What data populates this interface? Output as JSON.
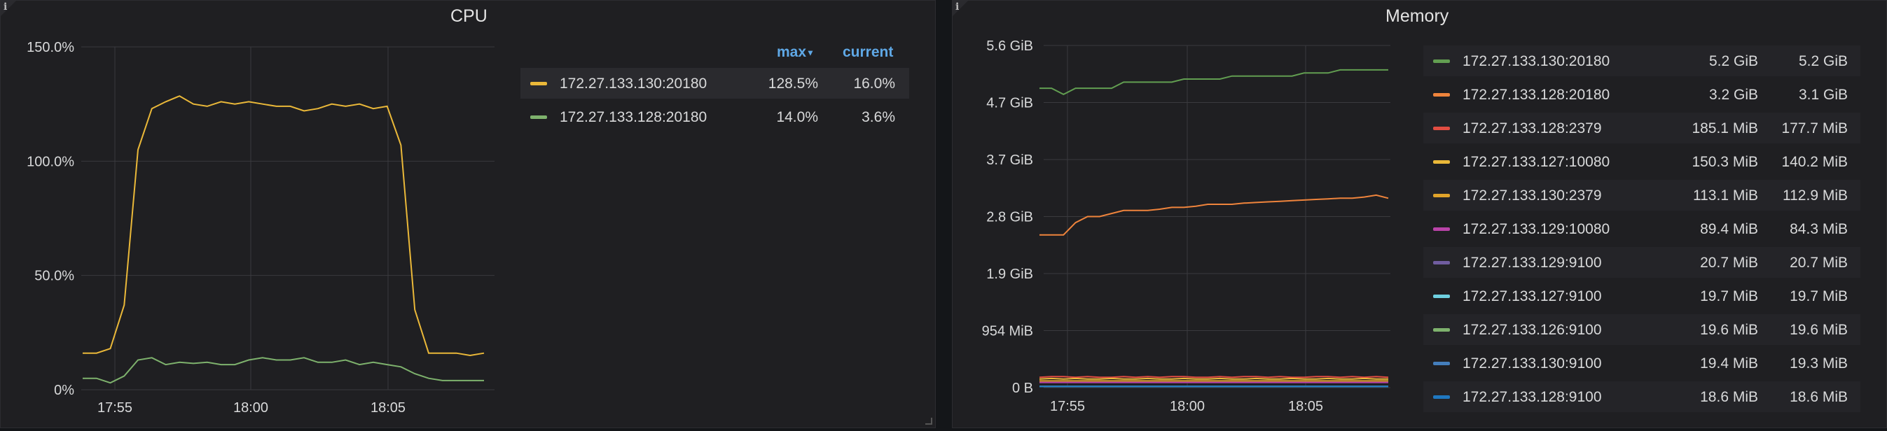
{
  "cpu_panel": {
    "title": "CPU",
    "info_icon": "i",
    "legend_headers": {
      "max": "max",
      "current": "current"
    },
    "legend": [
      {
        "name": "172.27.133.130:20180",
        "max": "128.5%",
        "current": "16.0%",
        "color": "#eab839"
      },
      {
        "name": "172.27.133.128:20180",
        "max": "14.0%",
        "current": "3.6%",
        "color": "#7eb26d"
      }
    ]
  },
  "memory_panel": {
    "title": "Memory",
    "info_icon": "i",
    "legend": [
      {
        "name": "172.27.133.130:20180",
        "max": "5.2 GiB",
        "current": "5.2 GiB",
        "color": "#629e51"
      },
      {
        "name": "172.27.133.128:20180",
        "max": "3.2 GiB",
        "current": "3.1 GiB",
        "color": "#ef843c"
      },
      {
        "name": "172.27.133.128:2379",
        "max": "185.1 MiB",
        "current": "177.7 MiB",
        "color": "#e24d42"
      },
      {
        "name": "172.27.133.127:10080",
        "max": "150.3 MiB",
        "current": "140.2 MiB",
        "color": "#eab839"
      },
      {
        "name": "172.27.133.130:2379",
        "max": "113.1 MiB",
        "current": "112.9 MiB",
        "color": "#e0a32a"
      },
      {
        "name": "172.27.133.129:10080",
        "max": "89.4 MiB",
        "current": "84.3 MiB",
        "color": "#ba43a9"
      },
      {
        "name": "172.27.133.129:9100",
        "max": "20.7 MiB",
        "current": "20.7 MiB",
        "color": "#705da0"
      },
      {
        "name": "172.27.133.127:9100",
        "max": "19.7 MiB",
        "current": "19.7 MiB",
        "color": "#6ed0e0"
      },
      {
        "name": "172.27.133.126:9100",
        "max": "19.6 MiB",
        "current": "19.6 MiB",
        "color": "#7eb26d"
      },
      {
        "name": "172.27.133.130:9100",
        "max": "19.4 MiB",
        "current": "19.3 MiB",
        "color": "#447ebc"
      },
      {
        "name": "172.27.133.128:9100",
        "max": "18.6 MiB",
        "current": "18.6 MiB",
        "color": "#1f78c1"
      }
    ]
  },
  "chart_data": [
    {
      "type": "line",
      "title": "CPU",
      "y_ticks": [
        "0%",
        "50.0%",
        "100.0%",
        "150.0%"
      ],
      "ylim": [
        0,
        150
      ],
      "x_ticks": [
        "17:55",
        "18:00",
        "18:05"
      ],
      "x": [
        "17:53:00",
        "17:53:30",
        "17:54:00",
        "17:54:30",
        "17:55:00",
        "17:55:30",
        "17:56:00",
        "17:56:30",
        "17:57:00",
        "17:57:30",
        "17:58:00",
        "17:58:30",
        "17:59:00",
        "17:59:30",
        "18:00:00",
        "18:00:30",
        "18:01:00",
        "18:01:30",
        "18:02:00",
        "18:02:30",
        "18:03:00",
        "18:03:30",
        "18:04:00",
        "18:04:30",
        "18:05:00",
        "18:05:30",
        "18:06:00",
        "18:06:30",
        "18:07:00",
        "18:07:30",
        "18:08:00",
        "18:08:30",
        "18:09:00",
        "18:09:30"
      ],
      "grid": true,
      "legend_position": "right",
      "series": [
        {
          "name": "172.27.133.130:20180",
          "color": "#eab839",
          "values": [
            16,
            16,
            18,
            37,
            105,
            123,
            126,
            128.5,
            125,
            124,
            126,
            125,
            126,
            125,
            124,
            124,
            122,
            123,
            125,
            124,
            125,
            123,
            124,
            107,
            35,
            16,
            16,
            16,
            15,
            16
          ]
        },
        {
          "name": "172.27.133.128:20180",
          "color": "#7eb26d",
          "values": [
            5,
            5,
            3,
            6,
            13,
            14,
            11,
            12,
            11.5,
            12,
            11,
            11,
            13,
            14,
            13,
            13,
            14,
            12,
            12,
            13,
            11,
            12,
            11,
            10,
            7,
            5,
            4,
            4,
            4,
            4
          ]
        }
      ]
    },
    {
      "type": "line",
      "title": "Memory",
      "y_ticks": [
        "0 B",
        "954 MiB",
        "1.9 GiB",
        "2.8 GiB",
        "3.7 GiB",
        "4.7 GiB",
        "5.6 GiB"
      ],
      "ylim": [
        0,
        5.6
      ],
      "y_unit": "GiB",
      "x_ticks": [
        "17:55",
        "18:00",
        "18:05"
      ],
      "grid": true,
      "legend_position": "right",
      "series": [
        {
          "name": "172.27.133.130:20180",
          "color": "#629e51",
          "values": [
            4.9,
            4.9,
            4.8,
            4.9,
            4.9,
            4.9,
            4.9,
            5.0,
            5.0,
            5.0,
            5.0,
            5.0,
            5.05,
            5.05,
            5.05,
            5.05,
            5.1,
            5.1,
            5.1,
            5.1,
            5.1,
            5.1,
            5.15,
            5.15,
            5.15,
            5.2,
            5.2,
            5.2,
            5.2,
            5.2
          ]
        },
        {
          "name": "172.27.133.128:20180",
          "color": "#ef843c",
          "values": [
            2.5,
            2.5,
            2.5,
            2.7,
            2.8,
            2.8,
            2.85,
            2.9,
            2.9,
            2.9,
            2.92,
            2.95,
            2.95,
            2.97,
            3.0,
            3.0,
            3.0,
            3.02,
            3.03,
            3.04,
            3.05,
            3.06,
            3.07,
            3.08,
            3.09,
            3.1,
            3.1,
            3.12,
            3.15,
            3.1
          ]
        },
        {
          "name": "172.27.133.128:2379",
          "color": "#e24d42",
          "values": [
            0.17,
            0.18,
            0.18,
            0.17,
            0.18,
            0.17,
            0.17,
            0.18,
            0.17,
            0.18,
            0.17,
            0.18,
            0.18,
            0.17,
            0.17,
            0.18,
            0.17,
            0.18,
            0.18,
            0.17,
            0.18,
            0.17,
            0.17,
            0.18,
            0.18,
            0.17,
            0.18,
            0.17,
            0.18,
            0.17
          ]
        },
        {
          "name": "172.27.133.127:10080",
          "color": "#eab839",
          "values": [
            0.14,
            0.15,
            0.14,
            0.15,
            0.14,
            0.14,
            0.15,
            0.14,
            0.14,
            0.15,
            0.14,
            0.14,
            0.15,
            0.14,
            0.14,
            0.15,
            0.14,
            0.14,
            0.15,
            0.14,
            0.14,
            0.15,
            0.14,
            0.14,
            0.15,
            0.14,
            0.14,
            0.15,
            0.14,
            0.14
          ]
        },
        {
          "name": "172.27.133.130:2379",
          "color": "#e0a32a",
          "values": [
            0.11,
            0.11,
            0.11,
            0.11,
            0.11,
            0.11,
            0.11,
            0.11,
            0.11,
            0.11,
            0.11,
            0.11,
            0.11,
            0.11,
            0.11,
            0.11,
            0.11,
            0.11,
            0.11,
            0.11,
            0.11,
            0.11,
            0.11,
            0.11,
            0.11,
            0.11,
            0.11,
            0.11,
            0.11,
            0.11
          ]
        },
        {
          "name": "172.27.133.129:10080",
          "color": "#ba43a9",
          "values": [
            0.085,
            0.085,
            0.085,
            0.085,
            0.085,
            0.085,
            0.085,
            0.085,
            0.085,
            0.085,
            0.085,
            0.085,
            0.085,
            0.085,
            0.085,
            0.085,
            0.085,
            0.085,
            0.085,
            0.085,
            0.085,
            0.085,
            0.085,
            0.085,
            0.085,
            0.085,
            0.085,
            0.085,
            0.085,
            0.085
          ]
        },
        {
          "name": "172.27.133.129:9100",
          "color": "#705da0",
          "values": [
            0.02,
            0.02,
            0.02,
            0.02,
            0.02,
            0.02,
            0.02,
            0.02,
            0.02,
            0.02,
            0.02,
            0.02,
            0.02,
            0.02,
            0.02,
            0.02,
            0.02,
            0.02,
            0.02,
            0.02,
            0.02,
            0.02,
            0.02,
            0.02,
            0.02,
            0.02,
            0.02,
            0.02,
            0.02,
            0.02
          ]
        },
        {
          "name": "172.27.133.127:9100",
          "color": "#6ed0e0",
          "values": [
            0.019,
            0.019,
            0.019,
            0.019,
            0.019,
            0.019,
            0.019,
            0.019,
            0.019,
            0.019,
            0.019,
            0.019,
            0.019,
            0.019,
            0.019,
            0.019,
            0.019,
            0.019,
            0.019,
            0.019,
            0.019,
            0.019,
            0.019,
            0.019,
            0.019,
            0.019,
            0.019,
            0.019,
            0.019,
            0.019
          ]
        },
        {
          "name": "172.27.133.126:9100",
          "color": "#7eb26d",
          "values": [
            0.019,
            0.019,
            0.019,
            0.019,
            0.019,
            0.019,
            0.019,
            0.019,
            0.019,
            0.019,
            0.019,
            0.019,
            0.019,
            0.019,
            0.019,
            0.019,
            0.019,
            0.019,
            0.019,
            0.019,
            0.019,
            0.019,
            0.019,
            0.019,
            0.019,
            0.019,
            0.019,
            0.019,
            0.019,
            0.019
          ]
        },
        {
          "name": "172.27.133.130:9100",
          "color": "#447ebc",
          "values": [
            0.019,
            0.019,
            0.019,
            0.019,
            0.019,
            0.019,
            0.019,
            0.019,
            0.019,
            0.019,
            0.019,
            0.019,
            0.019,
            0.019,
            0.019,
            0.019,
            0.019,
            0.019,
            0.019,
            0.019,
            0.019,
            0.019,
            0.019,
            0.019,
            0.019,
            0.019,
            0.019,
            0.019,
            0.019,
            0.019
          ]
        },
        {
          "name": "172.27.133.128:9100",
          "color": "#1f78c1",
          "values": [
            0.018,
            0.018,
            0.018,
            0.018,
            0.018,
            0.018,
            0.018,
            0.018,
            0.018,
            0.018,
            0.018,
            0.018,
            0.018,
            0.018,
            0.018,
            0.018,
            0.018,
            0.018,
            0.018,
            0.018,
            0.018,
            0.018,
            0.018,
            0.018,
            0.018,
            0.018,
            0.018,
            0.018,
            0.018,
            0.018
          ]
        }
      ]
    }
  ]
}
